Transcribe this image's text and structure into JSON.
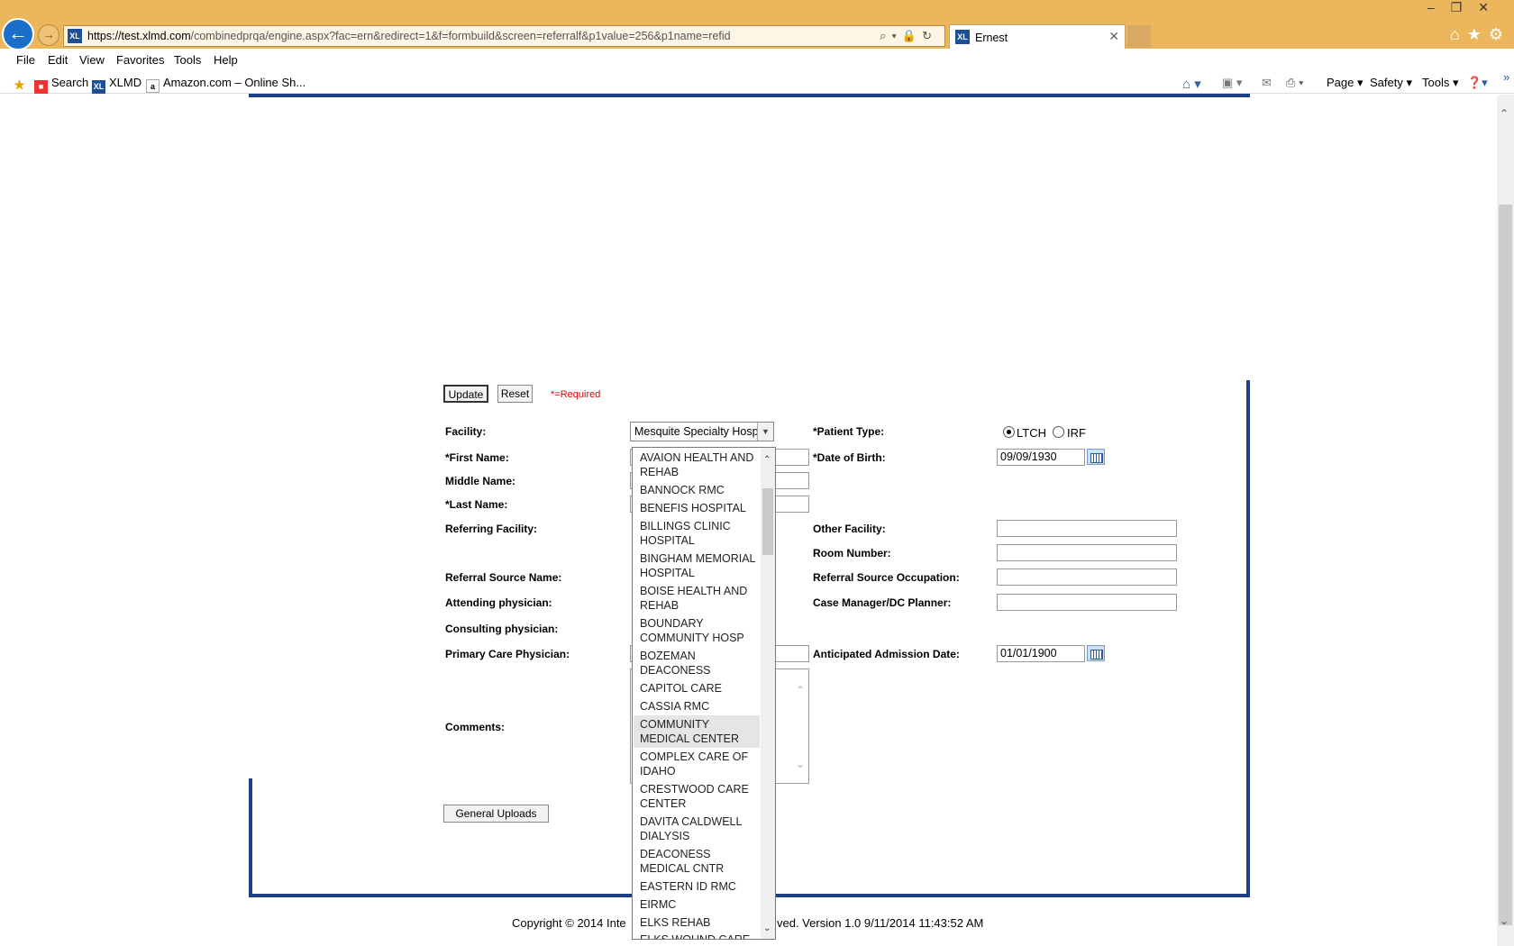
{
  "browser": {
    "url_host": "https://test.xlmd.com",
    "url_path": "/combinedprqa/engine.aspx?fac=ern&redirect=1&f=formbuild&screen=referralf&p1value=256&p1name=refid",
    "tab_title": "Ernest",
    "favicon_text": "XL",
    "menu": [
      "File",
      "Edit",
      "View",
      "Favorites",
      "Tools",
      "Help"
    ],
    "favorites": {
      "search": "Search",
      "xlmd": "XLMD",
      "amazon": "Amazon.com – Online Sh..."
    },
    "commands": {
      "page": "Page ▾",
      "safety": "Safety ▾",
      "tools": "Tools ▾"
    }
  },
  "form": {
    "update_label": "Update",
    "reset_label": "Reset",
    "required_note": "*=Required",
    "facility_label": "Facility:",
    "facility_value": "Mesquite Specialty  Hospi",
    "patient_type_label": "*Patient Type:",
    "patient_type_options": [
      "LTCH",
      "IRF"
    ],
    "first_name_label": "*First Name:",
    "dob_label": "*Date of Birth:",
    "dob_value": "09/09/1930",
    "middle_name_label": "Middle Name:",
    "last_name_label": "*Last Name:",
    "referring_facility_label": "Referring Facility:",
    "other_facility_label": "Other Facility:",
    "room_number_label": "Room Number:",
    "referral_source_name_label": "Referral Source Name:",
    "referral_source_occupation_label": "Referral Source Occupation:",
    "attending_physician_label": "Attending physician:",
    "case_manager_label": "Case Manager/DC Planner:",
    "consulting_physician_label": "Consulting physician:",
    "primary_care_label": "Primary Care Physician:",
    "anticipated_admission_label": "Anticipated Admission Date:",
    "anticipated_admission_value": "01/01/1900",
    "comments_label": "Comments:",
    "general_uploads_label": "General Uploads"
  },
  "dropdown": {
    "options": [
      "AVAION HEALTH AND REHAB",
      "BANNOCK RMC",
      "BENEFIS HOSPITAL",
      "BILLINGS CLINIC HOSPITAL",
      "BINGHAM MEMORIAL HOSPITAL",
      "BOISE HEALTH AND REHAB",
      "BOUNDARY COMMUNITY HOSP",
      "BOZEMAN DEACONESS",
      "CAPITOL CARE",
      "CASSIA RMC",
      "COMMUNITY MEDICAL CENTER",
      "COMPLEX CARE OF IDAHO",
      "CRESTWOOD CARE CENTER",
      "DAVITA CALDWELL DIALYSIS",
      "DEACONESS MEDICAL CNTR",
      "EASTERN ID RMC",
      "EIRMC",
      "ELKS REHAB",
      "ELKS WOUND CARE"
    ],
    "highlighted": "COMMUNITY MEDICAL CENTER"
  },
  "footer": {
    "left": "Copyright © 2014 Inte",
    "right": "ved. Version 1.0 9/11/2014 11:43:52 AM"
  },
  "colors": {
    "chrome": "#ecb65d",
    "frame": "#1c3f85",
    "required": "#e00000",
    "accent": "#1a6fc9"
  }
}
